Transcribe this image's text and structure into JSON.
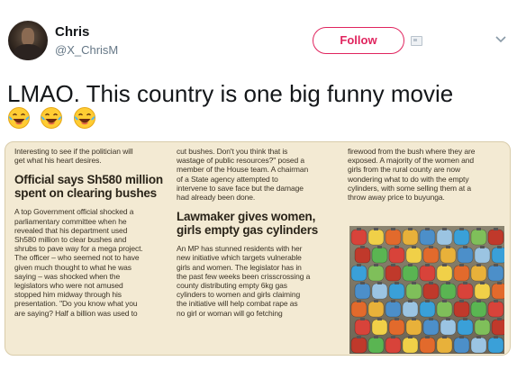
{
  "user": {
    "name": "Chris",
    "handle": "@X_ChrisM"
  },
  "header": {
    "follow_label": "Follow",
    "card_icon": "image-card-icon",
    "menu_icon": "chevron-down-icon"
  },
  "tweet": {
    "text": "LMAO. This country is one big funny movie",
    "emoji": [
      "face-with-tears-of-joy",
      "face-with-tears-of-joy",
      "face-with-tears-of-joy"
    ]
  },
  "clipping": {
    "col1_intro": "Interesting to see if the politician will\nget what his heart desires.",
    "headline1": "Official says Sh580 million\nspent on clearing bushes",
    "col1_body": "A top Government official shocked a\nparliamentary committee when he\nrevealed that his department used\nSh580 million to clear bushes and\nshrubs to pave way for a mega project.\nThe officer – who seemed not to have\ngiven much thought to what he was\nsaying – was shocked when the\nlegislators who were not amused\nstopped him midway through his\npresentation. \"Do you know what you\nare saying? Half a billion was used to",
    "col2_top": "cut bushes. Don't you think that is\nwastage of public resources?\" posed a\nmember of the House team. A chairman\nof a State agency attempted to\nintervene to save face but the damage\nhad already been done.",
    "headline2": "Lawmaker gives women,\ngirls empty gas cylinders",
    "col2_body": "An MP has stunned residents with her\nnew initiative which targets vulnerable\ngirls and women. The legislator has in\nthe past few weeks been crisscrossing a\ncounty distributing empty 6kg gas\ncylinders to women and girls claiming\nthe initiative will help combat rape as\nno girl or woman will go fetching",
    "col3_top": "firewood from the bush where they are\nexposed. A majority of the women and\ngirls from the rural county are now\nwondering what to do with the empty\ncylinders, with some selling them at a\nthrow away price to buyunga."
  },
  "colors": {
    "follow_accent": "#e0245e",
    "handle_gray": "#657786",
    "paper": "#f3ead3"
  }
}
